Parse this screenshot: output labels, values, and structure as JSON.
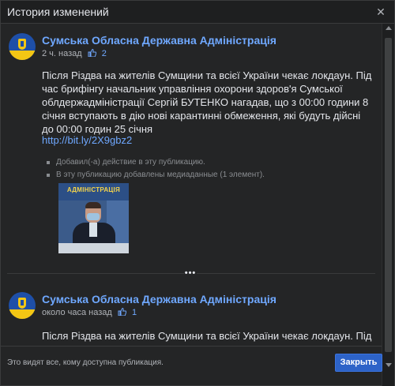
{
  "dialog": {
    "title": "История изменений",
    "close_icon": "close-icon"
  },
  "posts": [
    {
      "page_name": "Сумська Обласна Державна Адміністрація",
      "time": "2 ч. назад",
      "likes": "2",
      "text": "Після Різдва на жителів Сумщини та всієї України чекає локдаун. Під час брифінгу начальник управління охорони здоров'я Сумської облдержадміністрації Сергій БУТЕНКО нагадав, що з 00:00 години 8 січня вступають в дію нові карантинні обмеження, які будуть дійсні до 00:00 годин 25 січня",
      "link": "http://bit.ly/2X9gbz2",
      "changes": [
        "Добавил(-а) действие в эту публикацию.",
        "В эту публикацию добавлены медиаданные (1 элемент)."
      ],
      "media_banner": "АДМІНІСТРАЦІЯ"
    },
    {
      "page_name": "Сумська Обласна Державна Адміністрація",
      "time": "около часа назад",
      "likes": "1",
      "text": "Після Різдва на жителів Сумщини та всієї України чекає локдаун. Під"
    }
  ],
  "more_indicator": "•••",
  "footer": {
    "visibility_text": "Это видят все, кому доступна публикация.",
    "close_label": "Закрыть"
  },
  "colors": {
    "accent": "#2d63c8",
    "link": "#6fa8ff",
    "background": "#242526"
  }
}
